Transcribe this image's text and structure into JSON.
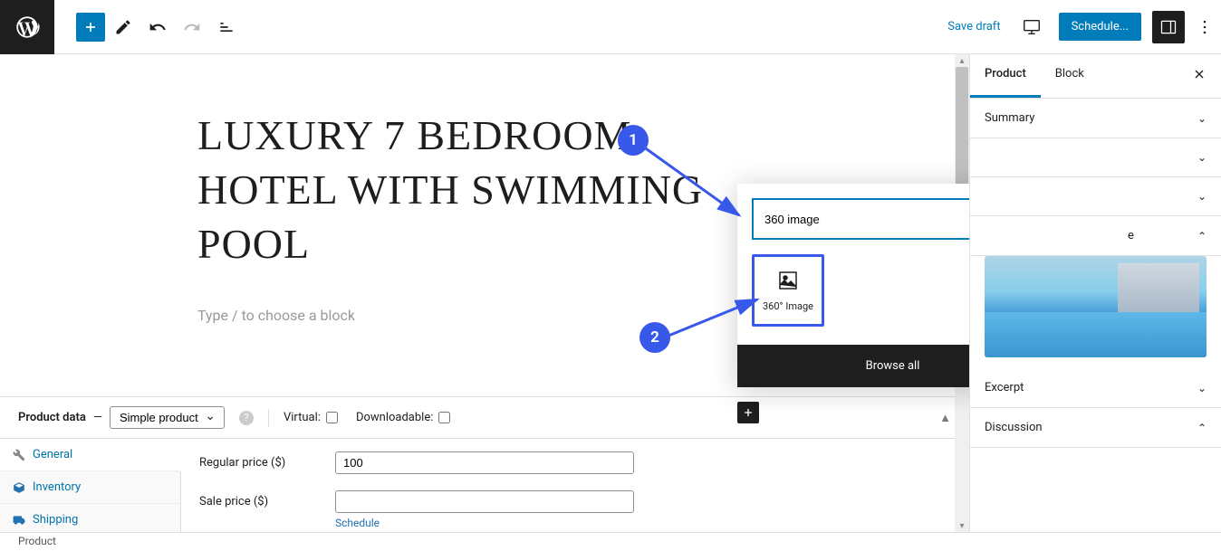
{
  "toolbar": {
    "save_draft": "Save draft",
    "schedule": "Schedule..."
  },
  "post": {
    "title": "LUXURY 7 BEDROOM HOTEL WITH SWIMMING POOL",
    "placeholder": "Type / to choose a block"
  },
  "inserter": {
    "search_value": "360 image",
    "result_label": "360° Image",
    "browse_all": "Browse all"
  },
  "steps": {
    "one": "1",
    "two": "2"
  },
  "product_data": {
    "header_label": "Product data",
    "dash": "—",
    "type_selected": "Simple product",
    "virtual_label": "Virtual:",
    "downloadable_label": "Downloadable:",
    "tabs": [
      "General",
      "Inventory",
      "Shipping"
    ],
    "regular_price_label": "Regular price ($)",
    "regular_price_value": "100",
    "sale_price_label": "Sale price ($)",
    "sale_price_value": "",
    "schedule_link": "Schedule"
  },
  "sidebar": {
    "tabs": {
      "product": "Product",
      "block": "Block"
    },
    "panels": {
      "summary": "Summary",
      "image_partial": "e",
      "excerpt": "Excerpt",
      "discussion": "Discussion"
    }
  },
  "footer": {
    "breadcrumb": "Product"
  },
  "colors": {
    "primary": "#007cba",
    "accent": "#3858e9"
  }
}
